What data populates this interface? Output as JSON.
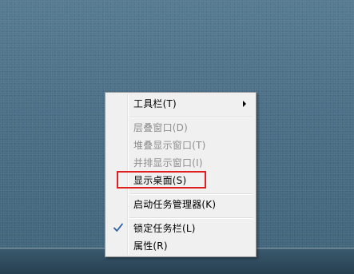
{
  "context_menu": {
    "items": [
      {
        "label": "工具栏(T)",
        "enabled": true,
        "has_submenu": true
      },
      {
        "label": "层叠窗口(D)",
        "enabled": false
      },
      {
        "label": "堆叠显示窗口(T)",
        "enabled": false
      },
      {
        "label": "并排显示窗口(I)",
        "enabled": false
      },
      {
        "label": "显示桌面(S)",
        "enabled": true,
        "highlighted": true
      },
      {
        "label": "启动任务管理器(K)",
        "enabled": true
      },
      {
        "label": "锁定任务栏(L)",
        "enabled": true,
        "checked": true
      },
      {
        "label": "属性(R)",
        "enabled": true
      }
    ],
    "icons": {
      "submenu": "chevron-right-icon",
      "check": "check-icon"
    }
  },
  "colors": {
    "menu_background": "#f0f0f0",
    "disabled_text": "#8d8d8d",
    "highlight_border": "#e02020",
    "check_mark": "#2c5ea8",
    "desktop": "#4d7088"
  }
}
